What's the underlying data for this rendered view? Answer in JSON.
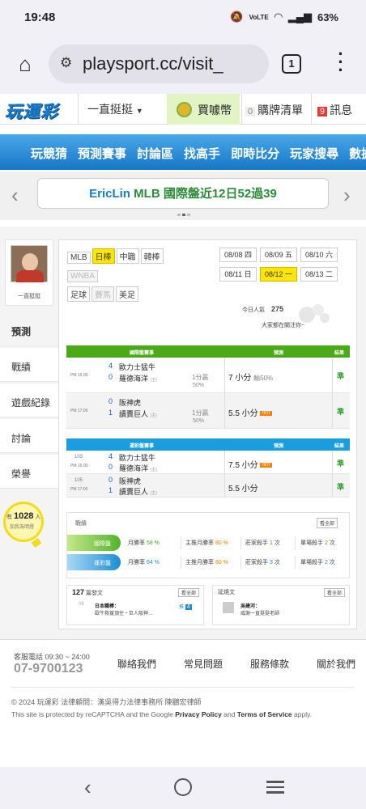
{
  "status_bar": {
    "time": "19:48",
    "battery": "63%",
    "net": "VoLTE"
  },
  "browser": {
    "url": "playsport.cc/visit_",
    "tab_count": "1"
  },
  "site_header": {
    "logo": "玩運彩",
    "user_menu": "一直挺挺",
    "buy": "買噱幣",
    "cart_count": "0",
    "cart": "購牌清單",
    "msg_count": "9",
    "messages": "訊息"
  },
  "main_nav": [
    "玩競猜",
    "預測賽事",
    "討論區",
    "找高手",
    "即時比分",
    "玩家搜尋",
    "數據"
  ],
  "banner": {
    "name": "EricLin",
    "text": "MLB 國際盤近12日52過39"
  },
  "sidebar": {
    "username": "一直挺挺",
    "tabs": [
      "預測",
      "戰績",
      "遊戲紀錄",
      "討論",
      "榮譽"
    ],
    "promo_prefix": "有",
    "promo_count": "1028",
    "promo_suffix": "人",
    "promo_sub": "加我為明燈"
  },
  "leagues": [
    {
      "label": "MLB",
      "state": "normal"
    },
    {
      "label": "日棒",
      "state": "on"
    },
    {
      "label": "中職",
      "state": "normal"
    },
    {
      "label": "韓棒",
      "state": "normal"
    },
    {
      "label": "WNBA",
      "state": "dim"
    },
    {
      "label": "足球",
      "state": "normal"
    },
    {
      "label": "賽馬",
      "state": "dim"
    },
    {
      "label": "美足",
      "state": "normal"
    }
  ],
  "dates": [
    {
      "label": "08/08 四",
      "on": false
    },
    {
      "label": "08/09 五",
      "on": false
    },
    {
      "label": "08/10 六",
      "on": false
    },
    {
      "label": "08/11 日",
      "on": false
    },
    {
      "label": "08/12 一",
      "on": true
    },
    {
      "label": "08/13 二",
      "on": false
    }
  ],
  "today_views": {
    "label": "今日人氣",
    "value": "275",
    "sub": "大家都在關注你~"
  },
  "intl_table": {
    "header": {
      "game": "國際盤賽事",
      "pick": "預測",
      "result": "結果"
    },
    "color": "#4aaa18",
    "rows": [
      {
        "time": "PM 16:00",
        "s1": "4",
        "t1": "歐力士猛牛",
        "s2": "0",
        "t2": "羅德海洋",
        "home": "(主)",
        "spread": "1分贏",
        "spread2": "50%",
        "pick": "7 小分",
        "pick_note": "輸50%",
        "hot": "",
        "result": "準"
      },
      {
        "time": "PM 17:00",
        "s1": "0",
        "t1": "阪神虎",
        "s2": "1",
        "t2": "讀賣巨人",
        "home": "(主)",
        "spread": "1分贏",
        "spread2": "50%",
        "pick": "5.5 小分",
        "pick_note": "",
        "hot": "HOT",
        "result": "準"
      }
    ]
  },
  "lottery_table": {
    "header": {
      "game": "運彩盤賽事",
      "pick": "預測",
      "result": "結果"
    },
    "color": "#1a9ee0",
    "rows": [
      {
        "id": "103",
        "time": "PM 16:00",
        "s1": "4",
        "t1": "歐力士猛牛",
        "s2": "0",
        "t2": "羅德海洋",
        "home": "(主)",
        "pick": "7.5 小分",
        "hot": "HOT",
        "result": "準"
      },
      {
        "id": "105",
        "time": "PM 17:00",
        "s1": "0",
        "t1": "阪神虎",
        "s2": "1",
        "t2": "讀賣巨人",
        "home": "(主)",
        "pick": "5.5 小分",
        "hot": "",
        "result": "準"
      }
    ]
  },
  "stats": {
    "title": "戰績",
    "more": "看全部",
    "rows": [
      {
        "label": "國際盤",
        "month": "月勝率",
        "month_val": "58 %",
        "major": "主推月勝率",
        "major_val": "80 %",
        "ranked": "莊家殺手",
        "ranked_val": "1",
        "ranked_unit": "次",
        "single": "單場殺手",
        "single_val": "2",
        "single_unit": "次"
      },
      {
        "label": "運彩盤",
        "month": "月勝率",
        "month_val": "64 %",
        "major": "主推月勝率",
        "major_val": "80 %",
        "ranked": "莊家殺手",
        "ranked_val": "3",
        "ranked_unit": "次",
        "single": "單場殺手",
        "single_val": "2",
        "single_unit": "次"
      }
    ]
  },
  "posts_panel": {
    "count": "127",
    "label": "篇發文",
    "more": "看全部",
    "date": "08",
    "title": "日本職棒：",
    "snippet": "歐牛救援頂住・巨人阪神…",
    "badge_label": "推",
    "badge_count": "4"
  },
  "replies_panel": {
    "label": "延燒文",
    "more": "看全部",
    "title": "吳建河：",
    "snippet": "威謝一直挺挺老師"
  },
  "footer": {
    "service_label": "客服電話 09:30 ~ 24:00",
    "phone": "07-9700123",
    "links": [
      "聯絡我們",
      "常見問題",
      "服務條款",
      "關於我們"
    ],
    "copyright": "© 2024 玩運彩  法律顧問：漢吳得力法律事務所 陳鵬宏律師",
    "captcha_pre": "This site is protected by reCAPTCHA and the Google ",
    "privacy": "Privacy Policy",
    "and": " and ",
    "terms": "Terms of Service",
    "apply": " apply."
  }
}
